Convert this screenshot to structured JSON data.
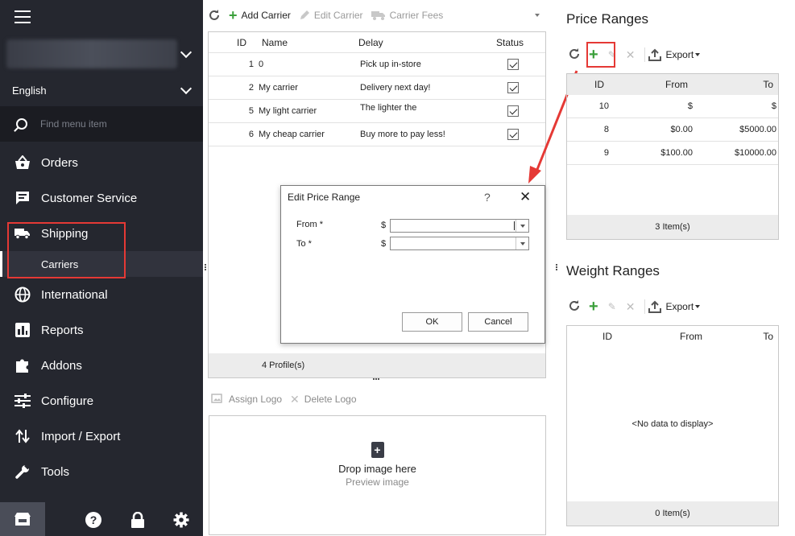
{
  "sidebar": {
    "language": "English",
    "search_placeholder": "Find menu item",
    "nav": [
      {
        "label": "Orders"
      },
      {
        "label": "Customer Service"
      },
      {
        "label": "Shipping"
      },
      {
        "label": "International"
      },
      {
        "label": "Reports"
      },
      {
        "label": "Addons"
      },
      {
        "label": "Configure"
      },
      {
        "label": "Import / Export"
      },
      {
        "label": "Tools"
      }
    ],
    "sub_item": "Carriers"
  },
  "carriers": {
    "toolbar": {
      "add": "Add Carrier",
      "edit": "Edit Carrier",
      "fees": "Carrier Fees"
    },
    "columns": {
      "id": "ID",
      "name": "Name",
      "delay": "Delay",
      "status": "Status"
    },
    "rows": [
      {
        "id": "1",
        "name": "0",
        "delay": "Pick up in-store"
      },
      {
        "id": "2",
        "name": "My carrier",
        "delay": "Delivery next day!"
      },
      {
        "id": "5",
        "name": "My light carrier",
        "delay": "The lighter the"
      },
      {
        "id": "6",
        "name": "My cheap carrier",
        "delay": "Buy more to pay less!"
      }
    ],
    "footer": "4 Profile(s)"
  },
  "logo": {
    "assign": "Assign Logo",
    "delete": "Delete Logo",
    "drop": "Drop image here",
    "preview": "Preview image"
  },
  "dialog": {
    "title": "Edit Price Range",
    "help": "?",
    "from_label": "From *",
    "to_label": "To *",
    "currency": "$",
    "ok": "OK",
    "cancel": "Cancel"
  },
  "price_ranges": {
    "title": "Price Ranges",
    "export": "Export",
    "columns": {
      "id": "ID",
      "from": "From",
      "to": "To"
    },
    "rows": [
      {
        "id": "10",
        "from": "$",
        "to": "$"
      },
      {
        "id": "8",
        "from": "$0.00",
        "to": "$5000.00"
      },
      {
        "id": "9",
        "from": "$100.00",
        "to": "$10000.00"
      }
    ],
    "footer": "3 Item(s)"
  },
  "weight_ranges": {
    "title": "Weight Ranges",
    "export": "Export",
    "columns": {
      "id": "ID",
      "from": "From",
      "to": "To"
    },
    "empty": "<No data to display>",
    "footer": "0 Item(s)"
  },
  "colors": {
    "sidebar": "#25272f",
    "accent_red": "#e53935",
    "plus_green": "#3ba03b"
  }
}
